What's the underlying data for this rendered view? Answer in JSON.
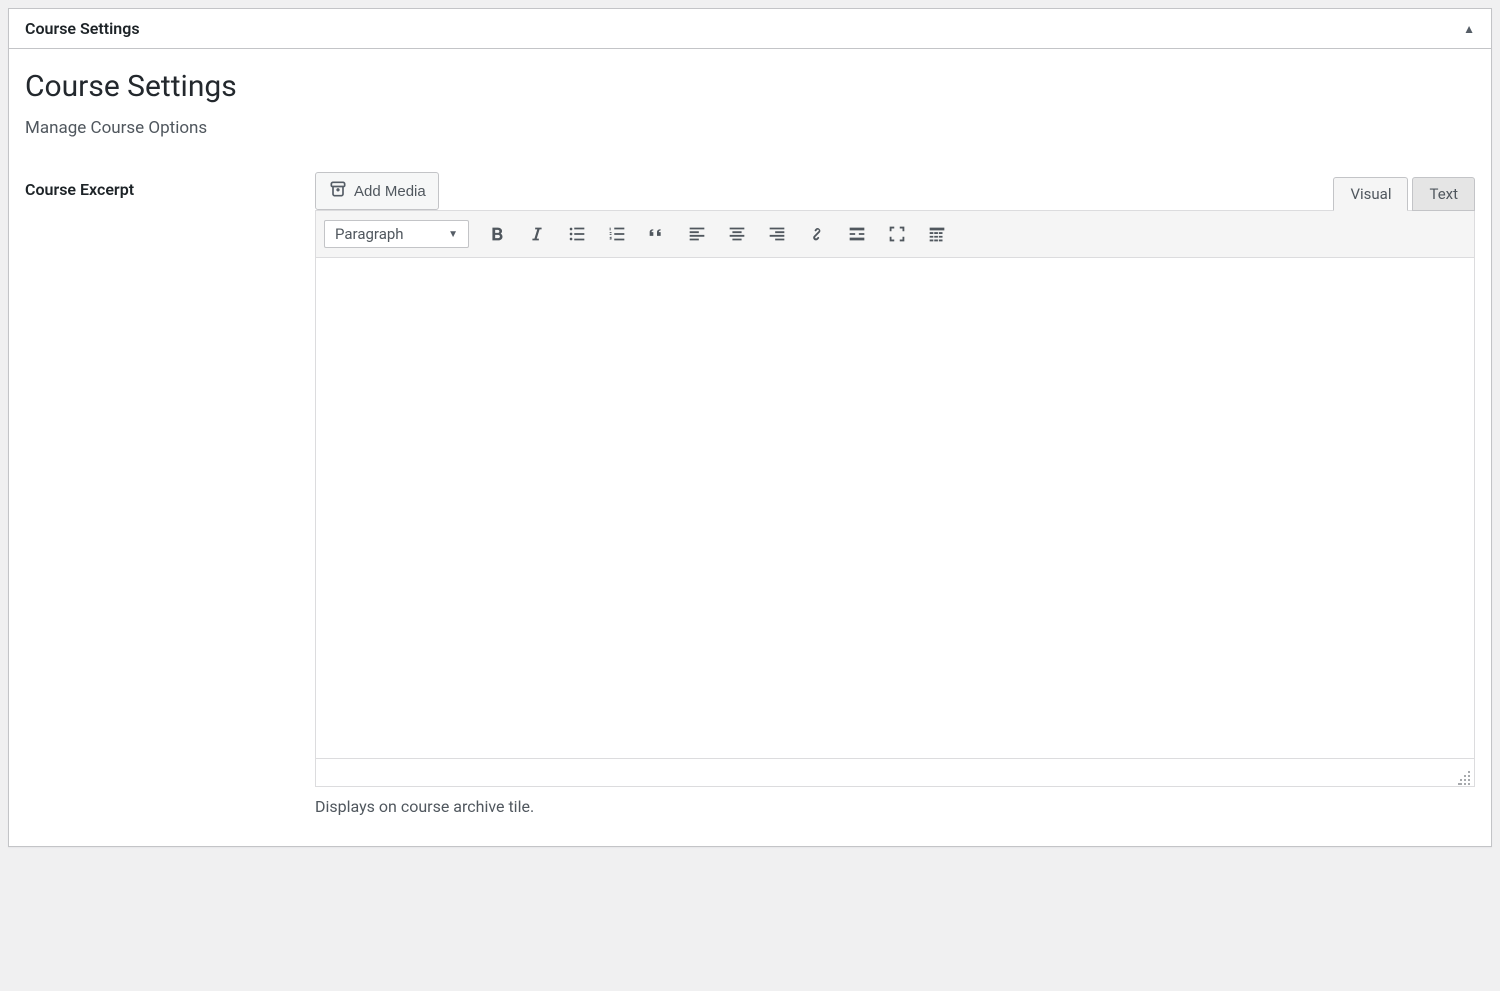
{
  "metabox": {
    "header_title": "Course Settings"
  },
  "section": {
    "title": "Course Settings",
    "subtitle": "Manage Course Options"
  },
  "field": {
    "label": "Course Excerpt",
    "help": "Displays on course archive tile."
  },
  "editor": {
    "add_media_label": "Add Media",
    "tabs": {
      "visual": "Visual",
      "text": "Text"
    },
    "format_selected": "Paragraph",
    "content": ""
  }
}
